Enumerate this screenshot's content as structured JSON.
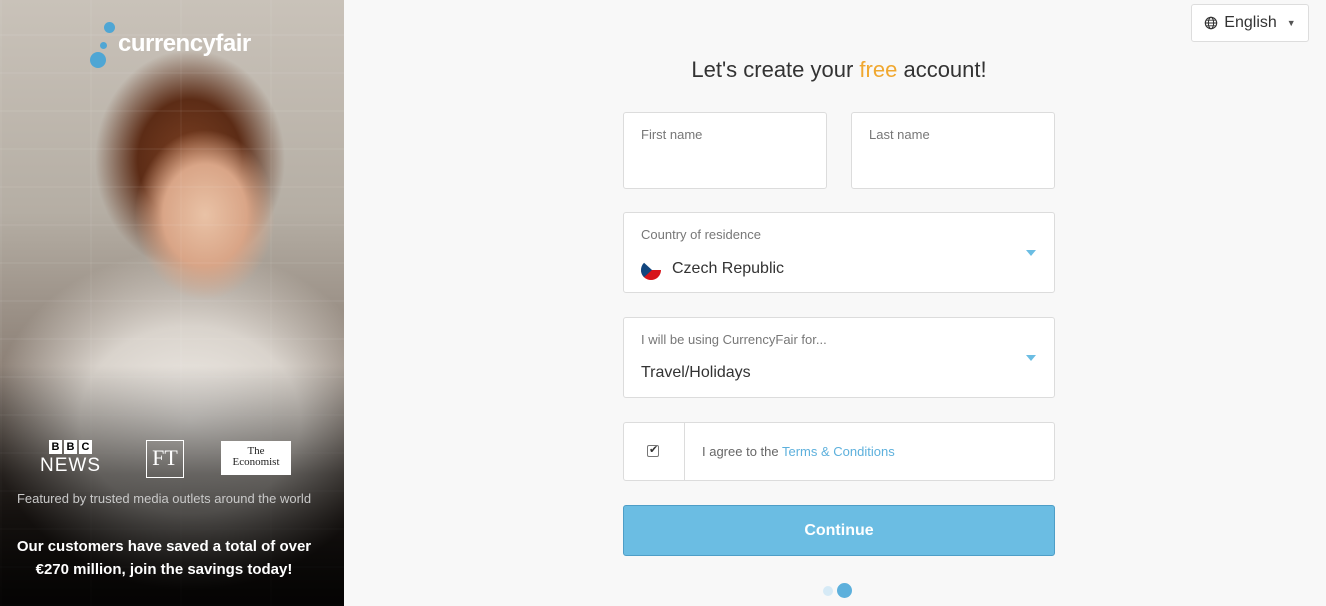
{
  "brand": {
    "name": "currencyfair"
  },
  "language": {
    "label": "English",
    "icon": "globe-icon"
  },
  "page": {
    "title_pre": "Let's create your ",
    "title_free": "free",
    "title_post": " account!"
  },
  "media": {
    "bbc_letters": [
      "B",
      "B",
      "C"
    ],
    "bbc_news": "NEWS",
    "ft": "FT",
    "economist_line1": "The",
    "economist_line2": "Economist",
    "featured_text": "Featured by trusted media outlets around the world",
    "savings_line1": "Our customers have saved a total of over",
    "savings_line2": "€270 million, join the savings today!"
  },
  "form": {
    "first_name": {
      "label": "First name",
      "value": ""
    },
    "last_name": {
      "label": "Last name",
      "value": ""
    },
    "country": {
      "label": "Country of residence",
      "value": "Czech Republic",
      "flag_icon": "czech-flag-icon"
    },
    "usage": {
      "label": "I will be using CurrencyFair for...",
      "value": "Travel/Holidays"
    },
    "terms": {
      "checked": true,
      "text": "I agree to the ",
      "link": "Terms & Conditions"
    },
    "continue_label": "Continue"
  },
  "steps": {
    "current": 2,
    "total": 2
  },
  "colors": {
    "accent": "#6bbde3",
    "link": "#5db0dc",
    "free": "#f0a830"
  }
}
